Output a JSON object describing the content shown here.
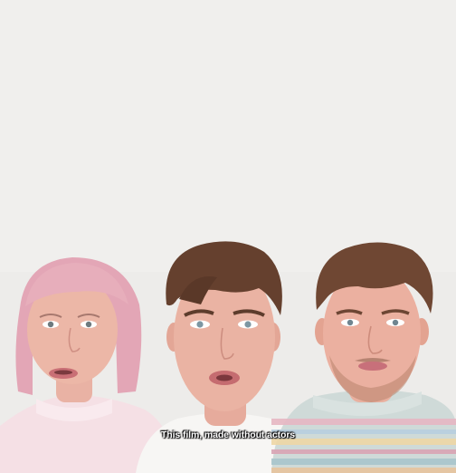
{
  "scene": {
    "description_colors": {
      "background": "#efeeec",
      "pink_hair": "#e5a9b8",
      "brown_hair": "#6a4330",
      "skin": "#eab3a3",
      "pink_sweater": "#f4dde2",
      "striped_sweater": "#cfd9d6"
    }
  },
  "subtitle": {
    "text": "This film, made without actors"
  }
}
